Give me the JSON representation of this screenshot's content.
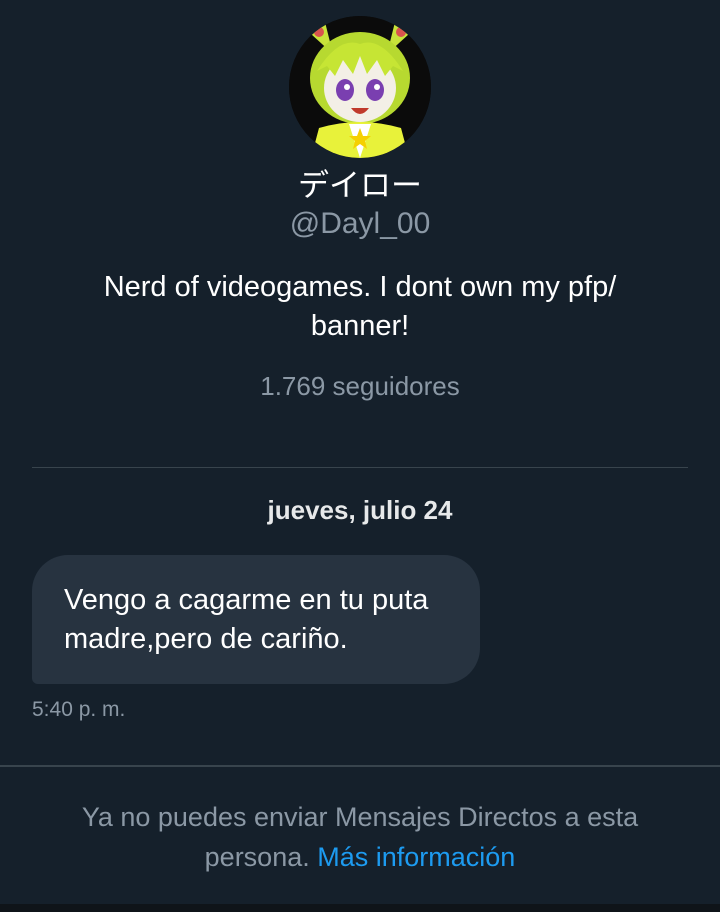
{
  "profile": {
    "display_name": "デイロー",
    "handle": "@Dayl_00",
    "bio": "Nerd of videogames. I dont own my pfp/ banner!",
    "followers": "1.769 seguidores",
    "avatar_icon": "anime-character-avatar"
  },
  "conversation": {
    "date_separator": "jueves, julio 24",
    "messages": [
      {
        "text": "Vengo a cagarme en tu puta madre,pero de cariño.",
        "time": "5:40 p. m."
      }
    ]
  },
  "footer": {
    "notice_text": "Ya no puedes enviar Mensajes Directos a esta persona.",
    "link_text": "Más información"
  },
  "colors": {
    "background": "#15202b",
    "bubble": "#273340",
    "link": "#1d9bf0",
    "secondary_text": "#8b98a5"
  }
}
